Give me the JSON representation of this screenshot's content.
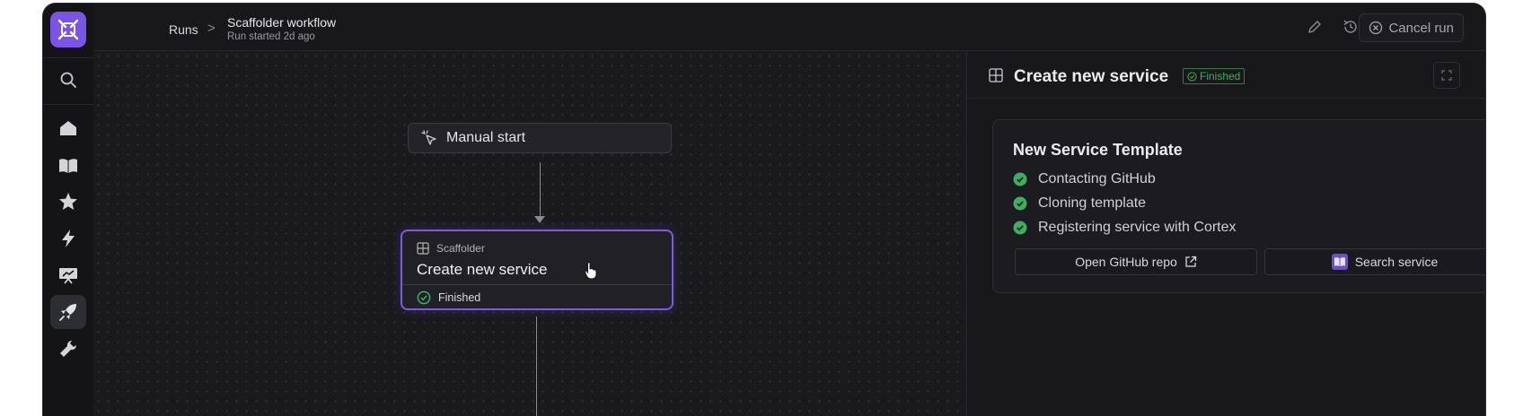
{
  "breadcrumb": {
    "root": "Runs",
    "separator": ">",
    "title": "Scaffolder workflow",
    "subtitle": "Run started 2d ago"
  },
  "header": {
    "cancel_label": "Cancel run"
  },
  "sidebar": {
    "items": [
      {
        "icon": "search-icon"
      },
      {
        "icon": "home-icon"
      },
      {
        "icon": "book-icon"
      },
      {
        "icon": "star-icon"
      },
      {
        "icon": "bolt-icon"
      },
      {
        "icon": "presentation-icon"
      },
      {
        "icon": "rocket-icon",
        "active": true
      },
      {
        "icon": "wrench-icon"
      }
    ]
  },
  "canvas": {
    "start_node": {
      "label": "Manual start"
    },
    "step_node": {
      "type": "Scaffolder",
      "title": "Create new service",
      "status": "Finished"
    }
  },
  "panel": {
    "title": "Create new service",
    "badge": "Finished",
    "card": {
      "title": "New Service Template",
      "steps": [
        {
          "label": "Contacting GitHub",
          "status": "done"
        },
        {
          "label": "Cloning template",
          "status": "done"
        },
        {
          "label": "Registering service with Cortex",
          "status": "done"
        }
      ],
      "buttons": {
        "open_repo": "Open GitHub repo",
        "search_service": "Search service"
      }
    }
  },
  "colors": {
    "accent": "#7c5ae8",
    "success": "#3fae5e",
    "background": "#17171a"
  }
}
